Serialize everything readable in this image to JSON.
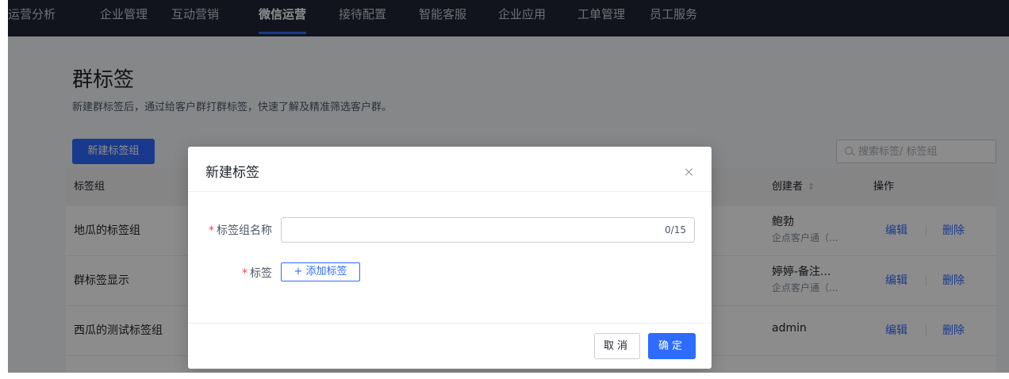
{
  "nav": {
    "items": [
      "运营分析",
      "企业管理",
      "互动营销",
      "微信运营",
      "接待配置",
      "智能客服",
      "企业应用",
      "工单管理",
      "员工服务"
    ],
    "active_index": 3
  },
  "page": {
    "title": "群标签",
    "description": "新建群标签后，通过给客户群打群标签，快速了解及精准筛选客户群。",
    "new_group_button": "新建标签组",
    "search_placeholder": "搜索标签/ 标签组"
  },
  "table": {
    "headers": {
      "group": "标签组",
      "creator": "创建者",
      "actions": "操作"
    },
    "rows": [
      {
        "name": "地瓜的标签组",
        "creator": "鲍勃",
        "creator_sub": "企点客户通（...",
        "edit": "编辑",
        "delete": "删除"
      },
      {
        "name": "群标签显示",
        "creator": "婷婷-备注...",
        "creator_sub": "企点客户通（...",
        "edit": "编辑",
        "delete": "删除"
      },
      {
        "name": "西瓜的测试标签组",
        "creator": "admin",
        "creator_sub": "",
        "edit": "编辑",
        "delete": "删除"
      }
    ]
  },
  "modal": {
    "title": "新建标签",
    "group_name_label": "标签组名称",
    "group_name_value": "",
    "char_count": "0/15",
    "tag_label": "标签",
    "add_tag_button": "+ 添加标签",
    "cancel_button": "取消",
    "confirm_button": "确定"
  },
  "colors": {
    "accent": "#2f6bff",
    "nav_bg": "#1f2636",
    "required": "#f53f3f"
  }
}
